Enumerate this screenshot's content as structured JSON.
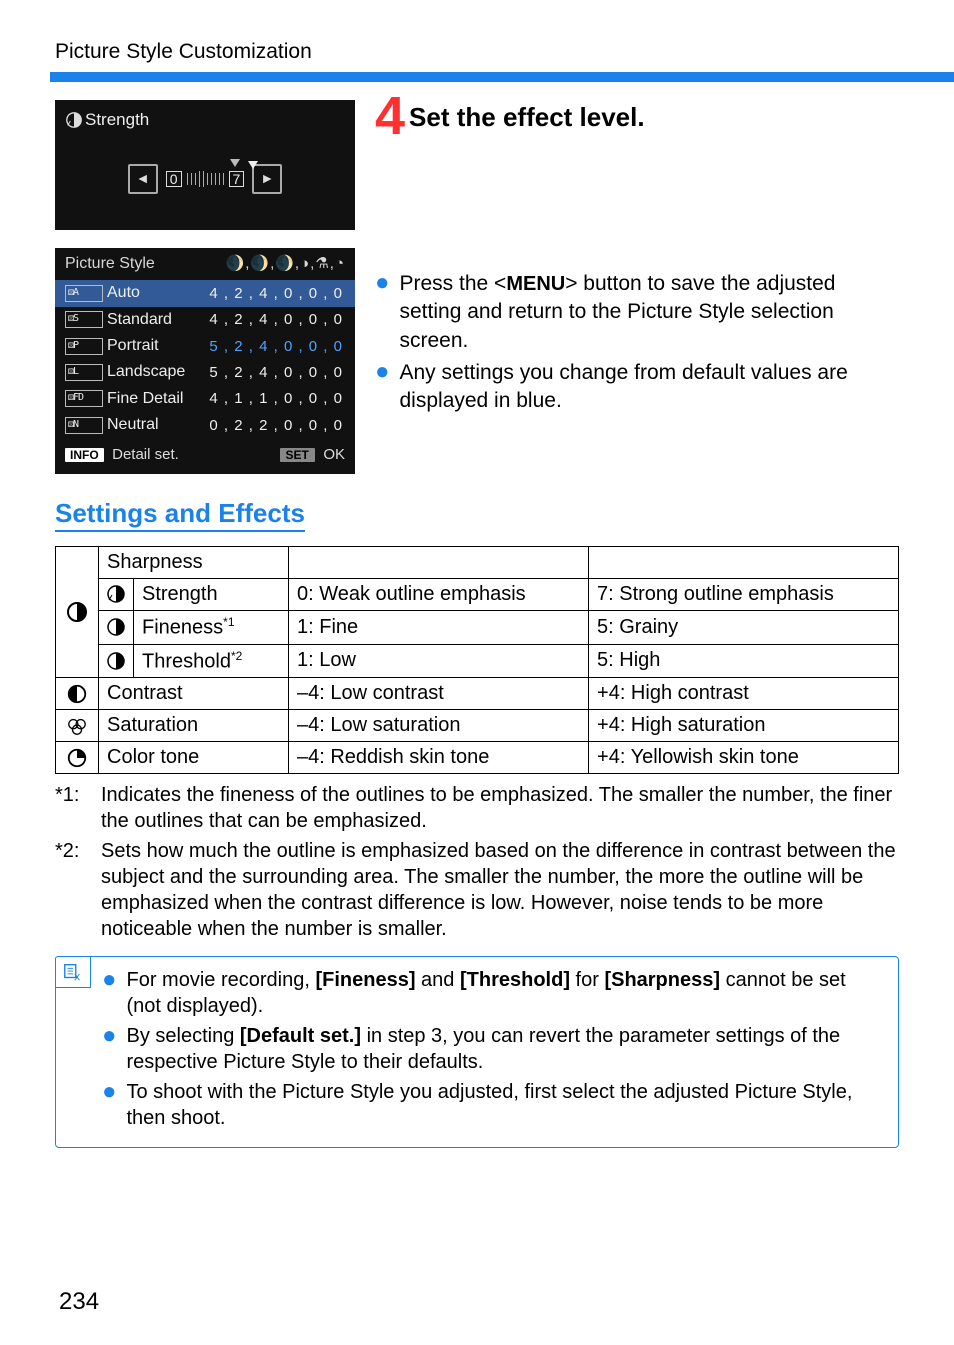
{
  "header": {
    "title": "Picture Style Customization"
  },
  "strength_panel": {
    "title": "Strength",
    "min_label": "0",
    "max_label": "7"
  },
  "ps_panel": {
    "title": "Picture Style",
    "header_syms": "🌒,🌒,🌒,◑,⚗,◔",
    "rows": [
      {
        "badge": "⚄A",
        "name": "Auto",
        "vals": "4 , 2 , 4 , 0 , 0 , 0",
        "selected": true,
        "blue": false
      },
      {
        "badge": "⚄S",
        "name": "Standard",
        "vals": "4 , 2 , 4 , 0 , 0 , 0",
        "selected": false,
        "blue": false
      },
      {
        "badge": "⚄P",
        "name": "Portrait",
        "vals": "5 , 2 , 4 , 0 , 0 , 0",
        "selected": false,
        "blue": true
      },
      {
        "badge": "⚄L",
        "name": "Landscape",
        "vals": "5 , 2 , 4 , 0 , 0 , 0",
        "selected": false,
        "blue": false
      },
      {
        "badge": "⚄FD",
        "name": "Fine Detail",
        "vals": "4 , 1 , 1 , 0 , 0 , 0",
        "selected": false,
        "blue": false
      },
      {
        "badge": "⚄N",
        "name": "Neutral",
        "vals": "0 , 2 , 2 , 0 , 0 , 0",
        "selected": false,
        "blue": false
      }
    ],
    "footer_left_badge": "INFO",
    "footer_left_label": "Detail set.",
    "footer_right_badge": "SET",
    "footer_right_label": "OK"
  },
  "step": {
    "number": "4",
    "title": "Set the effect level.",
    "body": [
      {
        "pre": "Press the <",
        "glyph": "MENU",
        "post": "> button to save the adjusted setting and return to the Picture Style selection screen."
      },
      {
        "pre": "Any settings you change from default values are displayed in blue.",
        "glyph": "",
        "post": ""
      }
    ]
  },
  "section_heading": "Settings and Effects",
  "fx_table": {
    "sharpness_label": "Sharpness",
    "sub": [
      {
        "name": "Strength",
        "low": "0: Weak outline emphasis",
        "high": "7: Strong outline emphasis",
        "sup": ""
      },
      {
        "name": "Fineness",
        "low": "1: Fine",
        "high": "5: Grainy",
        "sup": "*1"
      },
      {
        "name": "Threshold",
        "low": "1: Low",
        "high": "5: High",
        "sup": "*2"
      }
    ],
    "rows": [
      {
        "name": "Contrast",
        "low": "–4: Low contrast",
        "high": "+4: High contrast"
      },
      {
        "name": "Saturation",
        "low": "–4: Low saturation",
        "high": "+4: High saturation"
      },
      {
        "name": "Color tone",
        "low": "–4: Reddish skin tone",
        "high": "+4: Yellowish skin tone"
      }
    ]
  },
  "footnotes": [
    {
      "tag": "*1:",
      "text": "Indicates the fineness of the outlines to be emphasized. The smaller the number, the finer the outlines that can be emphasized."
    },
    {
      "tag": "*2:",
      "text": "Sets how much the outline is emphasized based on the difference in contrast between the subject and the surrounding area. The smaller the number, the more the outline will be emphasized when the contrast difference is low. However, noise tends to be more noticeable when the number is smaller."
    }
  ],
  "notes": [
    "For movie recording, [Fineness] and [Threshold] for [Sharpness] cannot be set (not displayed).",
    "By selecting [Default set.] in step 3, you can revert the parameter settings of the respective Picture Style to their defaults.",
    "To shoot with the Picture Style you adjusted, first select the adjusted Picture Style, then shoot."
  ],
  "page_number": "234"
}
